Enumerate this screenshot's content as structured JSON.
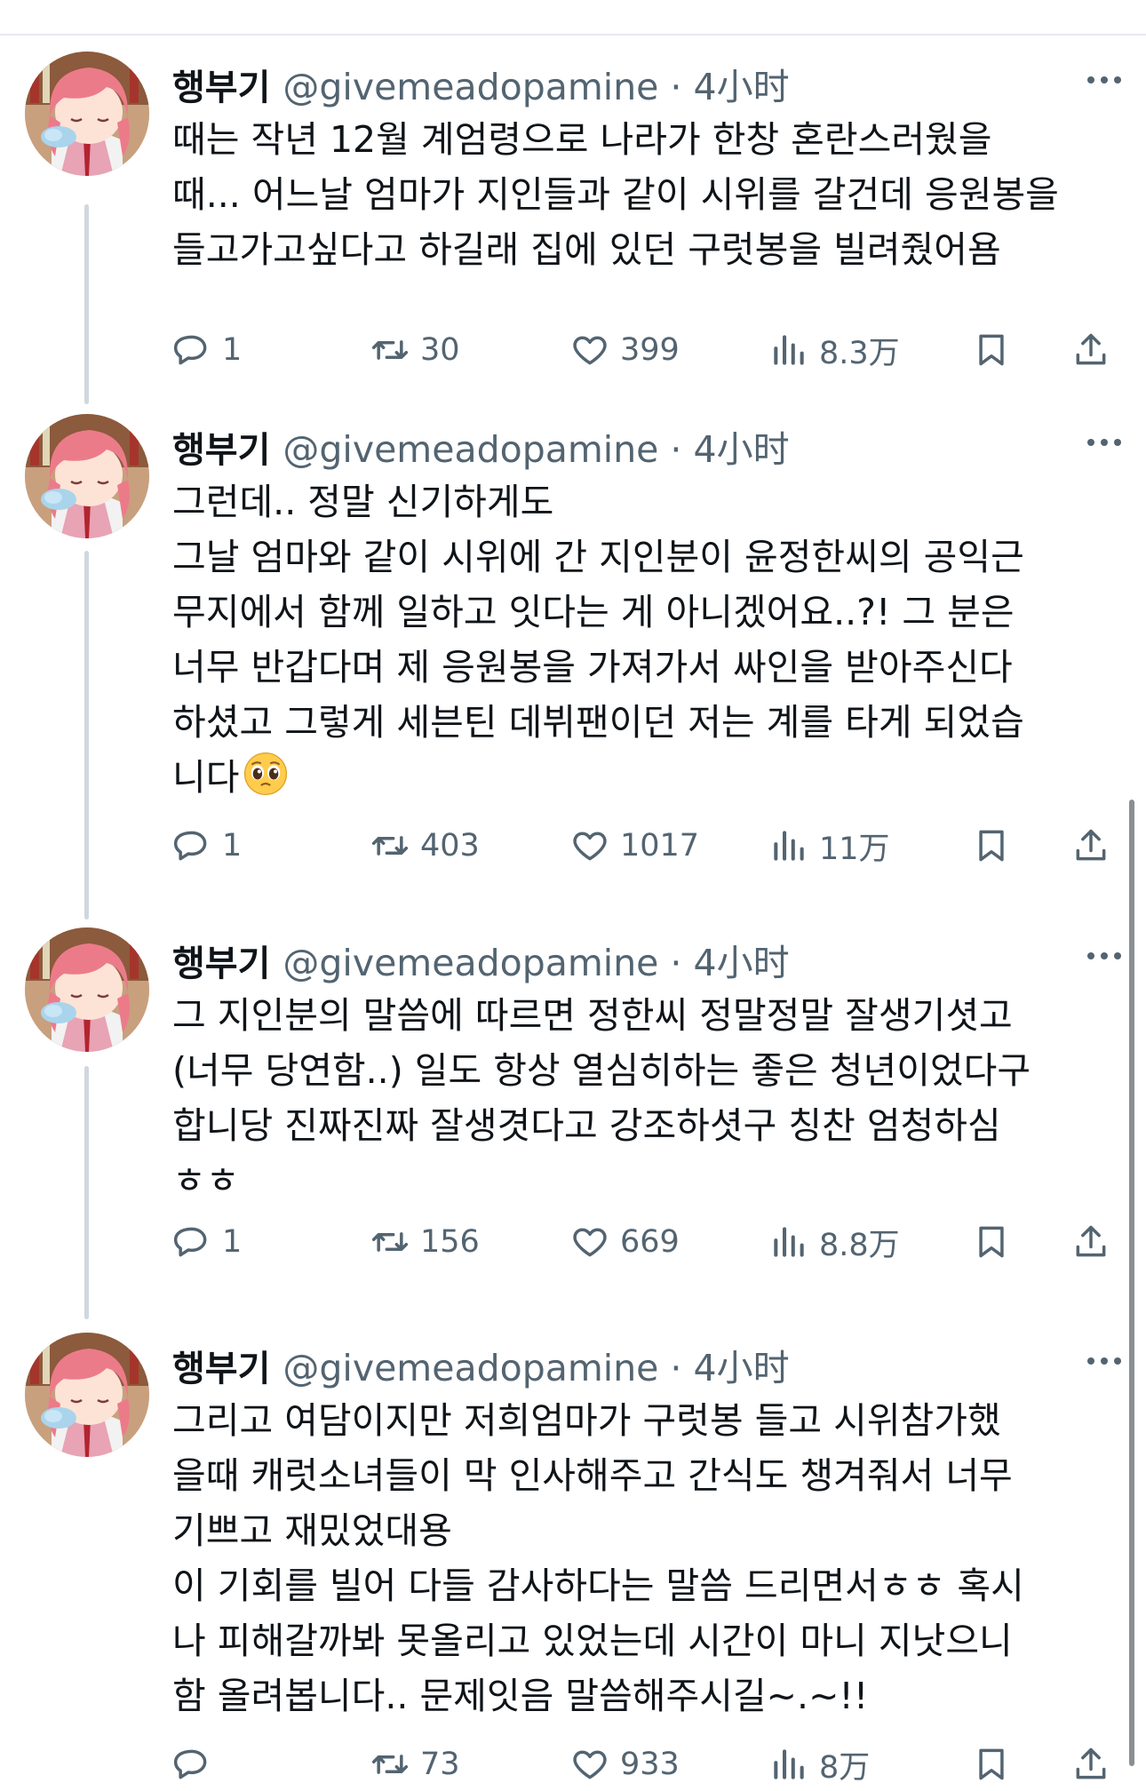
{
  "tweets": [
    {
      "name": "행부기",
      "handle": "@givemeadopamine · 4小时",
      "lines": [
        "때는 작년 12월 계엄령으로 나라가 한창 혼란스러웠을",
        "때... 어느날 엄마가 지인들과 같이 시위를 갈건데 응원봉을",
        "들고가고싶다고 하길래 집에 있던 구럿봉을 빌려줬어욤"
      ],
      "replies": "1",
      "retweets": "30",
      "likes": "399",
      "views": "8.3万"
    },
    {
      "name": "행부기",
      "handle": "@givemeadopamine · 4小时",
      "lines": [
        "그런데.. 정말 신기하게도",
        "그날 엄마와 같이 시위에 간 지인분이 윤정한씨의 공익근",
        "무지에서 함께 일하고 잇다는 게 아니겠어요..?! 그 분은",
        "너무 반갑다며 제 응원봉을 가져가서 싸인을 받아주신다",
        "하셨고 그렇게 세븐틴 데뷔팬이던 저는 계를 타게 되었습",
        "니다"
      ],
      "replies": "1",
      "retweets": "403",
      "likes": "1017",
      "views": "11万"
    },
    {
      "name": "행부기",
      "handle": "@givemeadopamine · 4小时",
      "lines": [
        "그 지인분의 말씀에 따르면 정한씨 정말정말 잘생기셧고",
        "(너무 당연함..) 일도 항상 열심히하는 좋은 청년이었다구",
        "합니당 진짜진짜 잘생겻다고 강조하셧구 칭찬 엄청하심",
        "ㅎㅎ"
      ],
      "replies": "1",
      "retweets": "156",
      "likes": "669",
      "views": "8.8万"
    },
    {
      "name": "행부기",
      "handle": "@givemeadopamine · 4小时",
      "lines": [
        "그리고 여담이지만 저희엄마가 구럿봉 들고 시위참가했",
        "을때 캐럿소녀들이 막 인사해주고 간식도 챙겨줘서 너무",
        "기쁘고 재밌었대용",
        "이 기회를 빌어 다들 감사하다는 말씀 드리면서ㅎㅎ 혹시",
        "나 피해갈까봐 못올리고 있었는데 시간이 마니 지낫으니",
        "함 올려봅니다.. 문제잇음 말씀해주시길~.~!!"
      ],
      "replies": "",
      "retweets": "73",
      "likes": "933",
      "views": "8万"
    }
  ],
  "icons": {
    "reply": "reply-icon",
    "retweet": "retweet-icon",
    "like": "heart-icon",
    "views": "views-chart-icon",
    "bookmark": "bookmark-icon",
    "share": "share-icon",
    "more": "more-dots-icon",
    "emoji": "pleading-face-emoji"
  },
  "colors": {
    "text": "#0f1419",
    "secondary": "#536471",
    "thread_line": "#d0d7de"
  }
}
